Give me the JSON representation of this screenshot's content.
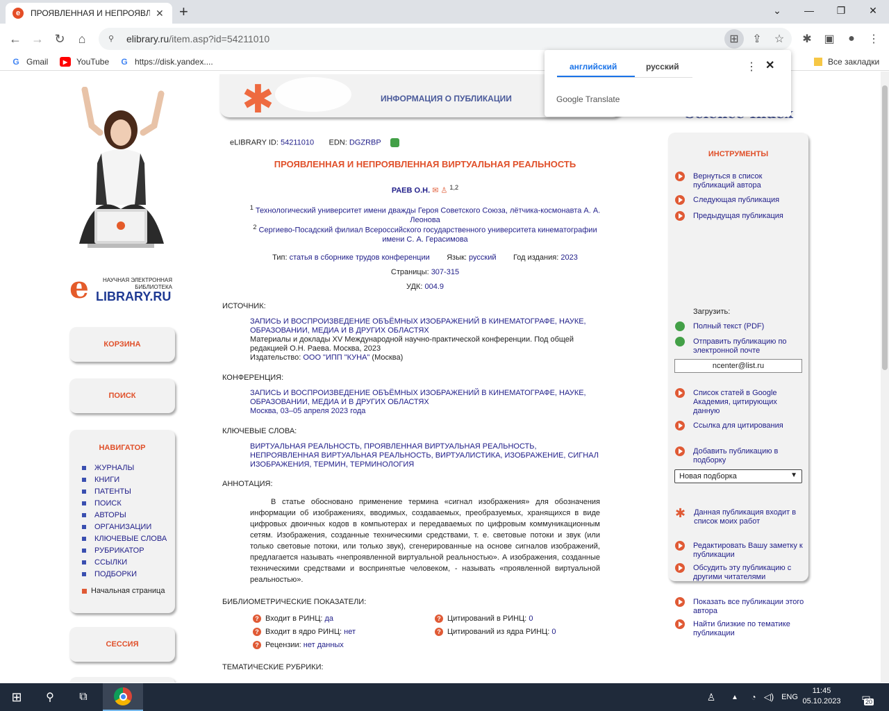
{
  "browser": {
    "tab_title": "ПРОЯВЛЕННАЯ И НЕПРОЯВЛЕННАЯ",
    "url_host": "elibrary.ru",
    "url_path": "/item.asp?id=54211010",
    "bookmarks": [
      "Gmail",
      "YouTube",
      "https://disk.yandex...."
    ],
    "all_bookmarks": "Все закладки"
  },
  "translate": {
    "lang_en": "английский",
    "lang_ru": "русский",
    "brand": "Google Translate"
  },
  "left": {
    "logo_line": "НАУЧНАЯ ЭЛЕКТРОННАЯ БИБЛИОТЕКА",
    "logo_brand": "LIBRARY.RU",
    "cart": "КОРЗИНА",
    "search": "ПОИСК",
    "navigator_title": "НАВИГАТОР",
    "nav_items": [
      "ЖУРНАЛЫ",
      "КНИГИ",
      "ПАТЕНТЫ",
      "ПОИСК",
      "АВТОРЫ",
      "ОРГАНИЗАЦИИ",
      "КЛЮЧЕВЫЕ СЛОВА",
      "РУБРИКАТОР",
      "ССЫЛКИ",
      "ПОДБОРКИ"
    ],
    "home": "Начальная страница",
    "session": "СЕССИЯ"
  },
  "banner": {
    "title": "ИНФОРМАЦИЯ О ПУБЛИКАЦИИ",
    "science_index": "Science Index"
  },
  "pub": {
    "id_label": "eLIBRARY ID:",
    "id": "54211010",
    "edn_label": "EDN:",
    "edn": "DGZRBP",
    "title": "ПРОЯВЛЕННАЯ И НЕПРОЯВЛЕННАЯ ВИРТУАЛЬНАЯ РЕАЛЬНОСТЬ",
    "author": "РАЕВ О.Н.",
    "author_sup": "1,2",
    "aff1_num": "1",
    "aff1": "Технологический университет имени дважды Героя Советского Союза, лётчика-космонавта А. А. Леонова",
    "aff2_num": "2",
    "aff2": "Сергиево-Посадский филиал Всероссийского государственного университета кинематографии имени С. А. Герасимова",
    "type_label": "Тип:",
    "type": "статья в сборнике трудов конференции",
    "lang_label": "Язык:",
    "lang": "русский",
    "year_label": "Год издания:",
    "year": "2023",
    "pages_label": "Страницы:",
    "pages": "307-315",
    "udk_label": "УДК:",
    "udk": "004.9",
    "source_label": "ИСТОЧНИК:",
    "source_title": "ЗАПИСЬ И ВОСПРОИЗВЕДЕНИЕ ОБЪЁМНЫХ ИЗОБРАЖЕНИЙ В КИНЕМАТОГРАФЕ, НАУКЕ, ОБРАЗОВАНИИ, МЕДИА И В ДРУГИХ ОБЛАСТЯХ",
    "source_desc": "Материалы и доклады XV Международной научно-практической конференции. Под общей редакцией О.Н. Раева. Москва, 2023",
    "publisher_label": "Издательство:",
    "publisher": "ООО \"ИПП \"КУНА\"",
    "publisher_city": "(Москва)",
    "conf_label": "КОНФЕРЕНЦИЯ:",
    "conf_title": "ЗАПИСЬ И ВОСПРОИЗВЕДЕНИЕ ОБЪЁМНЫХ ИЗОБРАЖЕНИЙ В КИНЕМАТОГРАФЕ, НАУКЕ, ОБРАЗОВАНИИ, МЕДИА И В ДРУГИХ ОБЛАСТЯХ",
    "conf_date": "Москва, 03–05 апреля 2023 года",
    "kw_label": "КЛЮЧЕВЫЕ СЛОВА:",
    "keywords": "ВИРТУАЛЬНАЯ РЕАЛЬНОСТЬ, ПРОЯВЛЕННАЯ ВИРТУАЛЬНАЯ РЕАЛЬНОСТЬ, НЕПРОЯВЛЕННАЯ ВИРТУАЛЬНАЯ РЕАЛЬНОСТЬ, ВИРТУАЛИСТИКА, ИЗОБРАЖЕНИЕ, СИГНАЛ ИЗОБРАЖЕНИЯ, ТЕРМИН, ТЕРМИНОЛОГИЯ",
    "abstract_label": "АННОТАЦИЯ:",
    "abstract": "В статье обосновано применение термина «сигнал изображения» для обозначения информации об изображениях, вводимых, создаваемых, преобразуемых, хранящихся в виде цифровых двоичных кодов в компьютерах и передаваемых по цифровым коммуникационным сетям. Изображения, созданные техническими средствами, т. е. световые потоки и звук (или только световые потоки, или только звук), сгенерированные на основе сигналов изображений, предлагается называть «непроявленной виртуальной реальностью». А изображения, созданные техническими средствами и воспринятые человеком, - называть «проявленной виртуальной реальностью».",
    "biblio_label": "БИБЛИОМЕТРИЧЕСКИЕ ПОКАЗАТЕЛИ:",
    "rinc_label": "Входит в РИНЦ:",
    "rinc": "да",
    "core_label": "Входит в ядро РИНЦ:",
    "core": "нет",
    "reviews_label": "Рецензии:",
    "reviews": "нет данных",
    "cit_label": "Цитирований в РИНЦ:",
    "cit": "0",
    "cit_core_label": "Цитирований из ядра РИНЦ:",
    "cit_core": "0",
    "rubrics_label": "ТЕМАТИЧЕСКИЕ РУБРИКИ:"
  },
  "tools": {
    "title": "ИНСТРУМЕНТЫ",
    "back": "Вернуться в список публикаций автора",
    "next": "Следующая публикация",
    "prev": "Предыдущая публикация",
    "download_label": "Загрузить:",
    "fulltext": "Полный текст (PDF)",
    "send": "Отправить публикацию по электронной почте",
    "email": "ncenter@list.ru",
    "scholar": "Список статей в Google Академия, цитирующих данную",
    "cite": "Ссылка для цитирования",
    "add": "Добавить публикацию в подборку",
    "collection": "Новая подборка",
    "my_works": "Данная публикация входит в список моих работ",
    "edit_note": "Редактировать Вашу заметку к публикации",
    "discuss": "Обсудить эту публикацию с другими читателями",
    "all_pubs": "Показать все публикации этого автора",
    "similar": "Найти близкие по тематике публикации"
  },
  "taskbar": {
    "lang": "ENG",
    "time": "11:45",
    "date": "05.10.2023",
    "notif": "20"
  }
}
